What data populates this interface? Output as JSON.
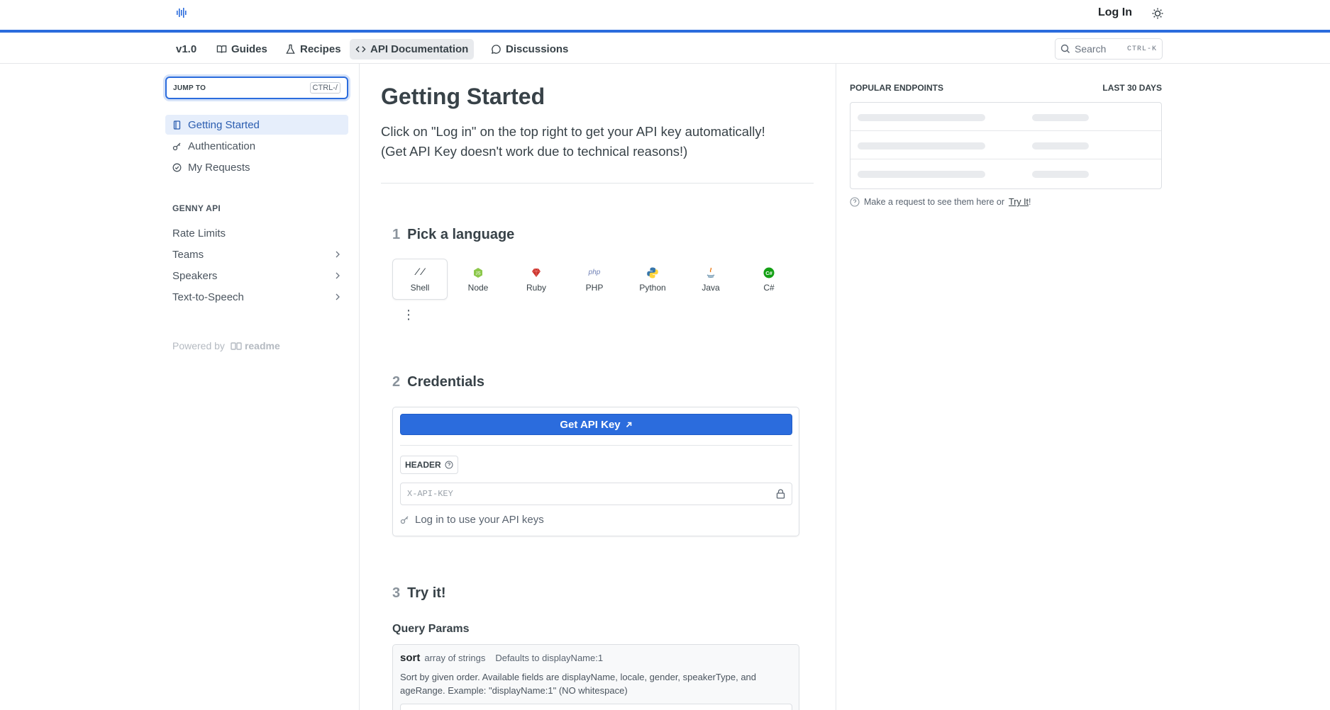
{
  "header": {
    "login_label": "Log In",
    "logo_icon": "waveform-icon",
    "theme_icon": "sun-icon",
    "accent_color": "#2b6cdd"
  },
  "nav": {
    "version": "v1.0",
    "items": [
      {
        "label": "Guides",
        "icon": "book-icon"
      },
      {
        "label": "Recipes",
        "icon": "flask-icon"
      },
      {
        "label": "API Documentation",
        "icon": "code-icon",
        "active": true
      },
      {
        "label": "Discussions",
        "icon": "chat-icon"
      }
    ],
    "search_placeholder": "Search",
    "search_shortcut": "CTRL-K"
  },
  "sidebar": {
    "jump_label": "JUMP TO",
    "jump_shortcut": "CTRL-/",
    "links": [
      {
        "label": "Getting Started",
        "icon": "page-icon",
        "active": true
      },
      {
        "label": "Authentication",
        "icon": "key-icon"
      },
      {
        "label": "My Requests",
        "icon": "check-circle-icon"
      }
    ],
    "section_heading": "GENNY API",
    "section_items": [
      {
        "label": "Rate Limits",
        "expandable": false
      },
      {
        "label": "Teams",
        "expandable": true
      },
      {
        "label": "Speakers",
        "expandable": true
      },
      {
        "label": "Text-to-Speech",
        "expandable": true
      }
    ],
    "powered_by": "Powered by",
    "powered_brand": "readme"
  },
  "main": {
    "title": "Getting Started",
    "excerpt_line1": "Click on \"Log in\" on the top right to get your API key automatically!",
    "excerpt_line2": "(Get API Key doesn't work due to technical reasons!)",
    "step1": {
      "num": "1",
      "label": "Pick a language"
    },
    "languages": [
      {
        "label": "Shell",
        "icon": "shell-icon",
        "active": true
      },
      {
        "label": "Node",
        "icon": "node-icon"
      },
      {
        "label": "Ruby",
        "icon": "ruby-icon"
      },
      {
        "label": "PHP",
        "icon": "php-icon"
      },
      {
        "label": "Python",
        "icon": "python-icon"
      },
      {
        "label": "Java",
        "icon": "java-icon"
      },
      {
        "label": "C#",
        "icon": "csharp-icon"
      }
    ],
    "step2": {
      "num": "2",
      "label": "Credentials"
    },
    "get_api_key_label": "Get API Key",
    "header_tag_label": "HEADER",
    "api_key_placeholder": "X-API-KEY",
    "login_hint": "Log in to use your API keys",
    "step3": {
      "num": "3",
      "label": "Try it!"
    },
    "query_params_title": "Query Params",
    "param": {
      "name": "sort",
      "type": "array of strings",
      "default": "Defaults to displayName:1",
      "description": "Sort by given order. Available fields are displayName, locale, gender, speakerType, and ageRange. Example: \"displayName:1\" (NO whitespace)"
    }
  },
  "rail": {
    "heading": "POPULAR ENDPOINTS",
    "period": "LAST 30 DAYS",
    "note_prefix": "Make a request to see them here or",
    "note_link": "Try It",
    "note_suffix": "!"
  }
}
